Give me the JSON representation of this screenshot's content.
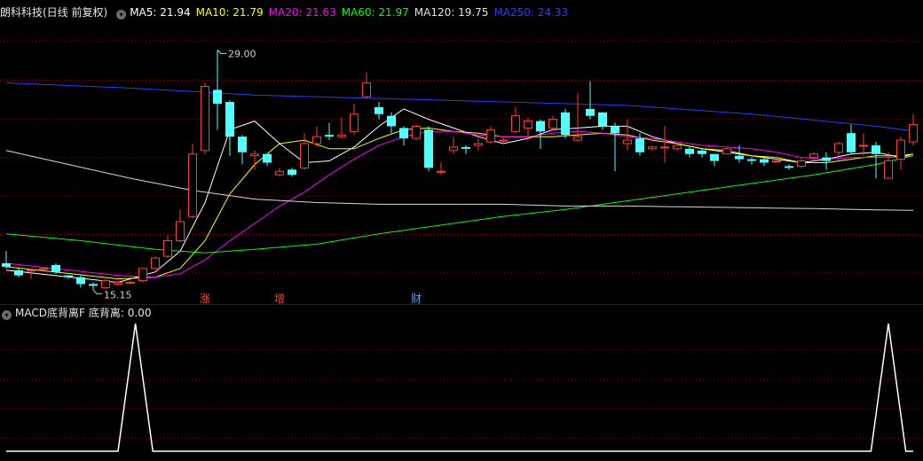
{
  "main_legend": {
    "title": "朗科科技(日线 前复权)",
    "items": [
      {
        "label": "MA5: 21.94",
        "color": "#ffffff"
      },
      {
        "label": "MA10: 21.79",
        "color": "#ffff00"
      },
      {
        "label": "MA20: 21.63",
        "color": "#ff00ff"
      },
      {
        "label": "MA60: 21.97",
        "color": "#00ff00"
      },
      {
        "label": "MA120: 19.75",
        "color": "#e0e0e0"
      },
      {
        "label": "MA250: 24.33",
        "color": "#2b3bff"
      }
    ]
  },
  "sub_legend": {
    "title": "MACD底背离F",
    "value_label": "底背离: 0.00"
  },
  "annotations": {
    "high_label": "29.00",
    "low_label": "15.15",
    "markers": [
      {
        "text": "涨",
        "color": "#ff4040"
      },
      {
        "text": "增",
        "color": "#ff4040"
      },
      {
        "text": "财",
        "color": "#4aa8ff"
      }
    ]
  },
  "colors": {
    "up": "#ff3c3c",
    "down": "#54ffff",
    "grid": "#8b0000"
  },
  "chart_data": [
    {
      "type": "candlestick",
      "title": "朗科科技(日线 前复权)",
      "ylim": [
        14.5,
        30.5
      ],
      "grid": true,
      "candles": [
        [
          16.7,
          16.5,
          17.4,
          16.4
        ],
        [
          16.3,
          16.0,
          16.4,
          15.9
        ],
        [
          16.3,
          16.3,
          16.4,
          15.8
        ],
        [
          16.4,
          16.4,
          16.5,
          16.3
        ],
        [
          16.6,
          16.2,
          16.7,
          16.1
        ],
        [
          16.0,
          15.9,
          16.0,
          15.8
        ],
        [
          15.9,
          15.5,
          16.0,
          15.3
        ],
        [
          15.5,
          15.4,
          15.6,
          15.15
        ],
        [
          15.3,
          15.7,
          15.8,
          15.2
        ],
        [
          15.5,
          15.6,
          15.7,
          15.4
        ],
        [
          15.6,
          15.6,
          15.7,
          15.5
        ],
        [
          15.7,
          16.4,
          16.4,
          15.6
        ],
        [
          16.4,
          17.0,
          17.1,
          16.3
        ],
        [
          17.1,
          18.0,
          18.3,
          17.0
        ],
        [
          18.0,
          19.1,
          19.8,
          17.9
        ],
        [
          19.4,
          23.0,
          23.6,
          19.3
        ],
        [
          23.2,
          26.9,
          27.1,
          23.0
        ],
        [
          26.7,
          25.9,
          29.0,
          24.4
        ],
        [
          26.0,
          24.0,
          26.1,
          22.9
        ],
        [
          24.0,
          23.1,
          24.1,
          22.4
        ],
        [
          22.9,
          23.0,
          23.2,
          22.1
        ],
        [
          23.0,
          22.5,
          23.0,
          22.3
        ],
        [
          21.8,
          22.0,
          22.2,
          21.7
        ],
        [
          22.1,
          21.8,
          22.2,
          21.7
        ],
        [
          22.2,
          23.6,
          24.2,
          22.1
        ],
        [
          23.6,
          24.0,
          24.6,
          23.4
        ],
        [
          24.1,
          24.0,
          24.8,
          23.8
        ],
        [
          24.0,
          24.1,
          25.1,
          23.9
        ],
        [
          24.3,
          25.3,
          25.9,
          24.1
        ],
        [
          26.3,
          27.1,
          27.7,
          26.2
        ],
        [
          25.7,
          25.3,
          26.0,
          25.0
        ],
        [
          25.2,
          24.6,
          25.4,
          24.2
        ],
        [
          24.5,
          23.9,
          24.6,
          23.5
        ],
        [
          23.9,
          24.6,
          24.7,
          23.8
        ],
        [
          24.4,
          22.2,
          24.6,
          22.0
        ],
        [
          22.0,
          22.0,
          22.5,
          21.8
        ],
        [
          23.2,
          23.4,
          24.0,
          23.0
        ],
        [
          23.4,
          23.3,
          23.5,
          23.0
        ],
        [
          23.5,
          23.6,
          23.9,
          23.2
        ],
        [
          23.7,
          24.4,
          24.6,
          23.6
        ],
        [
          23.8,
          23.8,
          24.0,
          23.6
        ],
        [
          24.3,
          25.2,
          25.7,
          24.2
        ],
        [
          24.5,
          24.9,
          25.1,
          23.8
        ],
        [
          24.9,
          24.3,
          25.0,
          23.3
        ],
        [
          24.5,
          25.0,
          25.2,
          24.4
        ],
        [
          25.4,
          24.1,
          25.6,
          23.9
        ],
        [
          23.8,
          24.0,
          26.5,
          23.7
        ],
        [
          25.6,
          25.2,
          27.2,
          25.0
        ],
        [
          25.4,
          24.6,
          25.4,
          24.4
        ],
        [
          24.6,
          24.2,
          24.8,
          22.0
        ],
        [
          23.6,
          23.8,
          25.0,
          23.2
        ],
        [
          23.9,
          23.1,
          24.2,
          22.9
        ],
        [
          23.3,
          23.4,
          23.5,
          23.2
        ],
        [
          23.4,
          23.4,
          24.6,
          22.5
        ],
        [
          23.3,
          23.5,
          23.6,
          23.2
        ],
        [
          23.3,
          23.0,
          23.4,
          22.8
        ],
        [
          23.2,
          23.0,
          23.3,
          22.8
        ],
        [
          23.0,
          22.6,
          23.0,
          22.3
        ],
        [
          23.0,
          23.3,
          23.4,
          23.0
        ],
        [
          22.9,
          22.7,
          23.5,
          22.5
        ],
        [
          22.7,
          22.6,
          22.8,
          22.4
        ],
        [
          22.7,
          22.5,
          22.8,
          22.3
        ],
        [
          22.6,
          22.6,
          22.7,
          22.5
        ],
        [
          22.3,
          22.2,
          22.4,
          22.1
        ],
        [
          22.3,
          22.6,
          22.8,
          22.2
        ],
        [
          22.8,
          23.0,
          23.1,
          22.6
        ],
        [
          22.8,
          22.6,
          23.1,
          22.1
        ],
        [
          23.1,
          23.6,
          23.7,
          22.9
        ],
        [
          24.2,
          23.1,
          24.7,
          23.0
        ],
        [
          23.5,
          23.5,
          24.2,
          22.9
        ],
        [
          23.5,
          23.0,
          23.7,
          21.6
        ],
        [
          21.6,
          22.6,
          23.1,
          21.6
        ],
        [
          22.7,
          23.8,
          24.0,
          22.1
        ],
        [
          23.7,
          24.7,
          25.3,
          23.5
        ]
      ],
      "ma_lines": [
        {
          "name": "MA5",
          "color": "#ffffff",
          "values": [
            [
              0,
              16.3
            ],
            [
              9,
              15.6
            ],
            [
              12,
              16.2
            ],
            [
              14,
              17.4
            ],
            [
              16,
              20.2
            ],
            [
              18,
              24.4
            ],
            [
              20,
              24.9
            ],
            [
              22,
              23.6
            ],
            [
              24,
              22.5
            ],
            [
              26,
              22.6
            ],
            [
              28,
              23.4
            ],
            [
              30,
              24.6
            ],
            [
              32,
              25.6
            ],
            [
              34,
              25.0
            ],
            [
              36,
              24.5
            ],
            [
              38,
              24.0
            ],
            [
              40,
              23.6
            ],
            [
              42,
              23.9
            ],
            [
              44,
              24.4
            ],
            [
              46,
              24.5
            ],
            [
              48,
              24.6
            ],
            [
              50,
              24.6
            ],
            [
              52,
              24.0
            ],
            [
              54,
              23.6
            ],
            [
              56,
              23.3
            ],
            [
              58,
              23.1
            ],
            [
              60,
              22.9
            ],
            [
              62,
              22.7
            ],
            [
              64,
              22.5
            ],
            [
              66,
              22.7
            ],
            [
              68,
              23.0
            ],
            [
              70,
              23.1
            ],
            [
              72,
              22.8
            ],
            [
              73,
              23.0
            ]
          ]
        },
        {
          "name": "MA10",
          "color": "#ffff00",
          "values": [
            [
              0,
              16.5
            ],
            [
              9,
              15.8
            ],
            [
              12,
              15.9
            ],
            [
              14,
              16.4
            ],
            [
              16,
              18.0
            ],
            [
              18,
              20.7
            ],
            [
              20,
              22.4
            ],
            [
              22,
              23.6
            ],
            [
              24,
              23.8
            ],
            [
              26,
              23.3
            ],
            [
              28,
              23.3
            ],
            [
              30,
              23.9
            ],
            [
              32,
              24.4
            ],
            [
              34,
              24.5
            ],
            [
              36,
              24.3
            ],
            [
              38,
              24.2
            ],
            [
              40,
              24.0
            ],
            [
              42,
              24.0
            ],
            [
              44,
              24.0
            ],
            [
              46,
              24.1
            ],
            [
              48,
              24.2
            ],
            [
              50,
              24.1
            ],
            [
              52,
              23.8
            ],
            [
              54,
              23.6
            ],
            [
              56,
              23.3
            ],
            [
              58,
              23.2
            ],
            [
              60,
              22.9
            ],
            [
              62,
              22.8
            ],
            [
              64,
              22.5
            ],
            [
              66,
              22.5
            ],
            [
              68,
              22.7
            ],
            [
              70,
              22.9
            ],
            [
              72,
              22.9
            ],
            [
              73,
              23.0
            ]
          ]
        },
        {
          "name": "MA20",
          "color": "#ff00ff",
          "values": [
            [
              0,
              16.7
            ],
            [
              9,
              16.0
            ],
            [
              12,
              15.9
            ],
            [
              14,
              16.1
            ],
            [
              16,
              16.9
            ],
            [
              18,
              18.0
            ],
            [
              20,
              19.0
            ],
            [
              22,
              20.0
            ],
            [
              24,
              20.8
            ],
            [
              26,
              21.8
            ],
            [
              28,
              22.7
            ],
            [
              30,
              23.5
            ],
            [
              32,
              24.0
            ],
            [
              34,
              24.3
            ],
            [
              36,
              24.3
            ],
            [
              38,
              24.1
            ],
            [
              40,
              24.0
            ],
            [
              42,
              24.0
            ],
            [
              44,
              24.2
            ],
            [
              46,
              24.3
            ],
            [
              48,
              24.2
            ],
            [
              50,
              24.0
            ],
            [
              52,
              23.9
            ],
            [
              54,
              23.7
            ],
            [
              56,
              23.5
            ],
            [
              58,
              23.4
            ],
            [
              60,
              23.3
            ],
            [
              62,
              23.1
            ],
            [
              64,
              22.8
            ],
            [
              66,
              22.7
            ],
            [
              68,
              22.8
            ],
            [
              70,
              22.8
            ],
            [
              72,
              22.8
            ],
            [
              73,
              22.9
            ]
          ]
        },
        {
          "name": "MA60",
          "color": "#00ff00",
          "values": [
            [
              0,
              18.4
            ],
            [
              6,
              18.0
            ],
            [
              12,
              17.5
            ],
            [
              16,
              17.3
            ],
            [
              20,
              17.5
            ],
            [
              25,
              17.8
            ],
            [
              30,
              18.4
            ],
            [
              35,
              18.9
            ],
            [
              40,
              19.4
            ],
            [
              45,
              19.8
            ],
            [
              50,
              20.3
            ],
            [
              55,
              20.8
            ],
            [
              60,
              21.3
            ],
            [
              65,
              21.8
            ],
            [
              70,
              22.4
            ],
            [
              73,
              22.9
            ]
          ]
        },
        {
          "name": "MA120",
          "color": "#d8d8d8",
          "values": [
            [
              0,
              23.2
            ],
            [
              5,
              22.4
            ],
            [
              10,
              21.6
            ],
            [
              15,
              20.9
            ],
            [
              20,
              20.4
            ],
            [
              25,
              20.2
            ],
            [
              30,
              20.1
            ],
            [
              35,
              20.1
            ],
            [
              40,
              20.1
            ],
            [
              45,
              20.0
            ],
            [
              50,
              20.0
            ],
            [
              55,
              19.95
            ],
            [
              60,
              19.9
            ],
            [
              65,
              19.85
            ],
            [
              70,
              19.78
            ],
            [
              73,
              19.75
            ]
          ]
        },
        {
          "name": "MA250",
          "color": "#2b3bff",
          "values": [
            [
              0,
              27.1
            ],
            [
              10,
              26.8
            ],
            [
              20,
              26.4
            ],
            [
              30,
              26.2
            ],
            [
              40,
              26.0
            ],
            [
              50,
              25.8
            ],
            [
              60,
              25.3
            ],
            [
              70,
              24.6
            ],
            [
              73,
              24.33
            ]
          ]
        }
      ]
    },
    {
      "type": "line",
      "title": "MACD底背离F",
      "series": [
        {
          "name": "底背离",
          "color": "#ffffff",
          "values": [
            [
              0,
              0
            ],
            [
              9.0,
              0
            ],
            [
              10.4,
              1
            ],
            [
              11.8,
              0
            ],
            [
              69.6,
              0
            ],
            [
              71.0,
              1
            ],
            [
              72.4,
              0
            ],
            [
              73,
              0
            ]
          ]
        }
      ],
      "ylim": [
        0,
        1
      ]
    }
  ]
}
